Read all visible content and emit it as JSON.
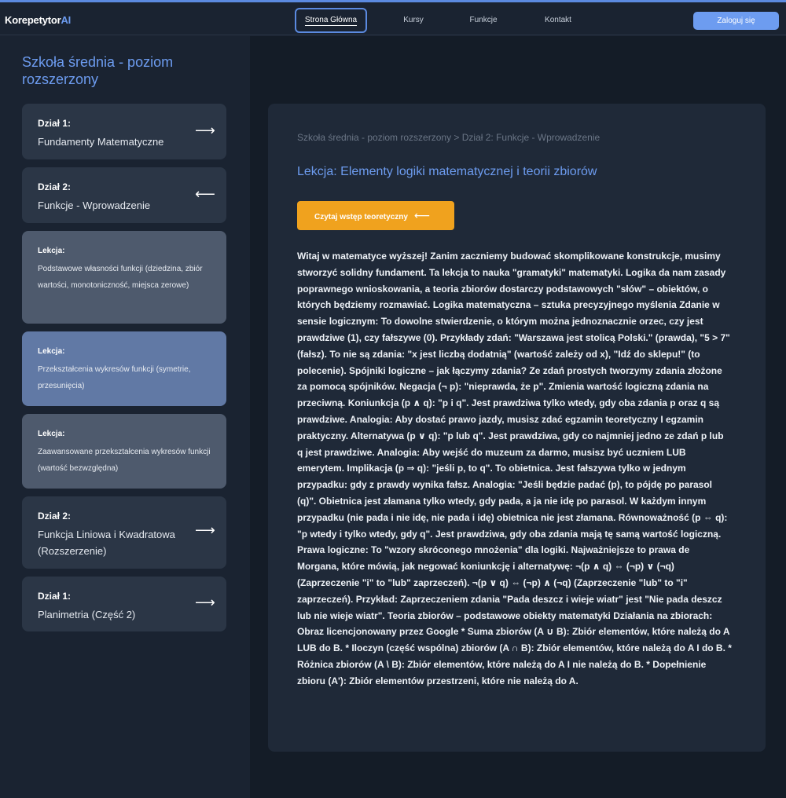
{
  "header": {
    "logo": {
      "main": "Korepetytor",
      "accent": "AI"
    },
    "nav": [
      {
        "label": "Strona Główna",
        "active": true
      },
      {
        "label": "Kursy",
        "active": false
      },
      {
        "label": "Funkcje",
        "active": false
      },
      {
        "label": "Kontakt",
        "active": false
      }
    ],
    "login_label": "Zaloguj się"
  },
  "sidebar": {
    "title": "Szkoła średnia - poziom rozszerzony",
    "cards": [
      {
        "type": "section",
        "label": "Dział 1:",
        "text": "Fundamenty Matematyczne",
        "icon": "arrow-right-icon",
        "arrow": "⟶"
      },
      {
        "type": "section",
        "label": "Dział 2:",
        "text": "Funkcje - Wprowadzenie",
        "icon": "arrow-left-icon",
        "arrow": "⟵"
      },
      {
        "type": "lesson",
        "label": "Lekcja:",
        "text": "Podstawowe własności funkcji (dziedzina, zbiór wartości, monotoniczność, miejsca zerowe)"
      },
      {
        "type": "lesson",
        "label": "Lekcja:",
        "text": "Przekształcenia wykresów funkcji (symetrie, przesunięcia)",
        "active": true
      },
      {
        "type": "lesson",
        "label": "Lekcja:",
        "text": "Zaawansowane przekształcenia wykresów funkcji (wartość bezwzględna)"
      },
      {
        "type": "section",
        "label": "Dział 2:",
        "text": "Funkcja Liniowa i Kwadratowa (Rozszerzenie)",
        "icon": "arrow-right-icon",
        "arrow": "⟶"
      },
      {
        "type": "section",
        "label": "Dział 1:",
        "text": "Planimetria (Część 2)",
        "icon": "arrow-right-icon",
        "arrow": "⟶"
      }
    ]
  },
  "main": {
    "breadcrumb": "Szkoła średnia - poziom rozszerzony > Dział 2: Funkcje - Wprowadzenie",
    "lesson_title": "Lekcja: Elementy logiki matematycznej i teorii zbiorów",
    "theory_button": {
      "label": "Czytaj wstęp teoretyczny",
      "arrow": "⟵"
    },
    "content": "Witaj w matematyce wyższej! Zanim zaczniemy budować skomplikowane konstrukcje, musimy stworzyć solidny fundament. Ta lekcja to nauka \"gramatyki\" matematyki. Logika da nam zasady poprawnego wnioskowania, a teoria zbiorów dostarczy podstawowych \"słów\" – obiektów, o których będziemy rozmawiać. Logika matematyczna – sztuka precyzyjnego myślenia Zdanie w sensie logicznym: To dowolne stwierdzenie, o którym można jednoznacznie orzec, czy jest prawdziwe (1), czy fałszywe (0). Przykłady zdań: \"Warszawa jest stolicą Polski.\" (prawda), \"5 > 7\" (fałsz). To nie są zdania: \"x jest liczbą dodatnią\" (wartość zależy od x), \"Idź do sklepu!\" (to polecenie). Spójniki logiczne – jak łączymy zdania? Ze zdań prostych tworzymy zdania złożone za pomocą spójników. Negacja (¬ p): \"nieprawda, że p\". Zmienia wartość logiczną zdania na przeciwną. Koniunkcja (p ∧ q): \"p i q\". Jest prawdziwa tylko wtedy, gdy oba zdania p oraz q są prawdziwe. Analogia: Aby dostać prawo jazdy, musisz zdać egzamin teoretyczny I egzamin praktyczny. Alternatywa (p ∨ q): \"p lub q\". Jest prawdziwa, gdy co najmniej jedno ze zdań p lub q jest prawdziwe. Analogia: Aby wejść do muzeum za darmo, musisz być uczniem LUB emerytem. Implikacja (p ⇒ q): \"jeśli p, to q\". To obietnica. Jest fałszywa tylko w jednym przypadku: gdy z prawdy wynika fałsz. Analogia: \"Jeśli będzie padać (p), to pójdę po parasol (q)\". Obietnica jest złamana tylko wtedy, gdy pada, a ja nie idę po parasol. W każdym innym przypadku (nie pada i nie idę, nie pada i idę) obietnica nie jest złamana. Równoważność (p ⇔ q): \"p wtedy i tylko wtedy, gdy q\". Jest prawdziwa, gdy oba zdania mają tę samą wartość logiczną. Prawa logiczne: To \"wzory skróconego mnożenia\" dla logiki. Najważniejsze to prawa de Morgana, które mówią, jak negować koniunkcję i alternatywę: ¬(p ∧ q) ⇔ (¬p) ∨ (¬q) (Zaprzeczenie \"i\" to \"lub\" zaprzeczeń). ¬(p ∨ q) ⇔ (¬p) ∧ (¬q) (Zaprzeczenie \"lub\" to \"i\" zaprzeczeń). Przykład: Zaprzeczeniem zdania \"Pada deszcz i wieje wiatr\" jest \"Nie pada deszcz lub nie wieje wiatr\". Teoria zbiorów – podstawowe obiekty matematyki Działania na zbiorach: Obraz licencjonowany przez Google * Suma zbiorów (A ∪ B): Zbiór elementów, które należą do A LUB do B. * Iloczyn (część wspólna) zbiorów (A ∩ B): Zbiór elementów, które należą do A I do B. * Różnica zbiorów (A \\ B): Zbiór elementów, które należą do A I nie należą do B. * Dopełnienie zbioru (A'): Zbiór elementów przestrzeni, które nie należą do A."
  },
  "colors": {
    "accent": "#6d9cf0",
    "button": "#f0a21e",
    "sidebar_bg": "#1a2331",
    "main_bg": "#141c27",
    "panel_bg": "#1f2938"
  }
}
